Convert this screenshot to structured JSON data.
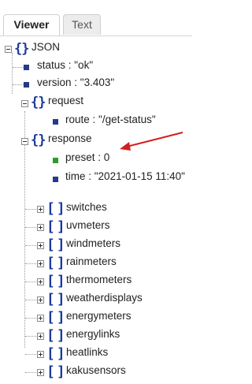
{
  "tabs": [
    {
      "label": "Viewer",
      "active": true
    },
    {
      "label": "Text",
      "active": false
    }
  ],
  "tree": {
    "root_label": "JSON",
    "status": "status : \"ok\"",
    "version": "version : \"3.403\"",
    "request_label": "request",
    "route": "route : \"/get-status\"",
    "response_label": "response",
    "preset": "preset : 0",
    "time": "time : \"2021-01-15 11:40\"",
    "arrays": [
      "switches",
      "uvmeters",
      "windmeters",
      "rainmeters",
      "thermometers",
      "weatherdisplays",
      "energymeters",
      "energylinks",
      "heatlinks",
      "kakusensors"
    ]
  },
  "colors": {
    "brace": "#1b3a9a",
    "leaf": "#243a8c",
    "highlight_leaf": "#2f9b2f",
    "arrow": "#d22020"
  }
}
